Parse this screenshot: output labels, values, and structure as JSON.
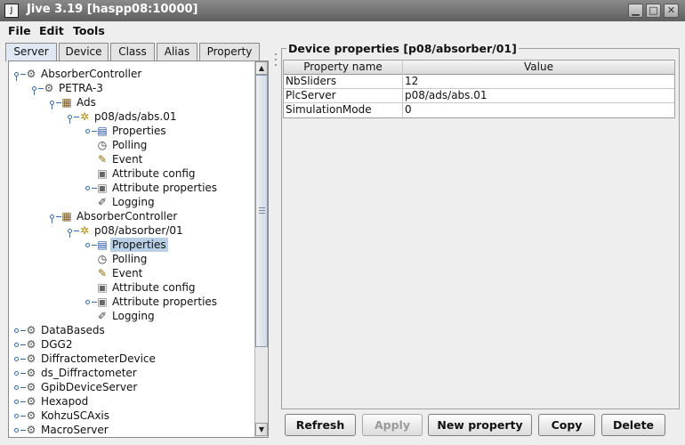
{
  "window": {
    "title": "Jive 3.19  [haspp08:10000]",
    "app_icon": "J"
  },
  "menu": [
    "File",
    "Edit",
    "Tools"
  ],
  "tabs": [
    "Server",
    "Device",
    "Class",
    "Alias",
    "Property"
  ],
  "tree": [
    {
      "label": "AbsorberController",
      "icon": "server-icon",
      "handle": "open"
    },
    {
      "label": "PETRA-3",
      "icon": "server-icon",
      "handle": "open"
    },
    {
      "label": "Ads",
      "icon": "class-icon",
      "handle": "open"
    },
    {
      "label": "p08/ads/abs.01",
      "icon": "device-icon",
      "handle": "open"
    },
    {
      "label": "Properties",
      "icon": "properties-icon",
      "handle": "closed"
    },
    {
      "label": "Polling",
      "icon": "polling-icon",
      "handle": ""
    },
    {
      "label": "Event",
      "icon": "event-icon",
      "handle": ""
    },
    {
      "label": "Attribute config",
      "icon": "attribute-config-icon",
      "handle": ""
    },
    {
      "label": "Attribute properties",
      "icon": "attribute-properties-icon",
      "handle": "closed"
    },
    {
      "label": "Logging",
      "icon": "logging-icon",
      "handle": ""
    },
    {
      "label": "AbsorberController",
      "icon": "class-icon",
      "handle": "open"
    },
    {
      "label": "p08/absorber/01",
      "icon": "device-icon",
      "handle": "open"
    },
    {
      "label": "Properties",
      "icon": "properties-icon",
      "handle": "closed",
      "selected": true
    },
    {
      "label": "Polling",
      "icon": "polling-icon",
      "handle": ""
    },
    {
      "label": "Event",
      "icon": "event-icon",
      "handle": ""
    },
    {
      "label": "Attribute config",
      "icon": "attribute-config-icon",
      "handle": ""
    },
    {
      "label": "Attribute properties",
      "icon": "attribute-properties-icon",
      "handle": "closed"
    },
    {
      "label": "Logging",
      "icon": "logging-icon",
      "handle": ""
    },
    {
      "label": "DataBaseds",
      "icon": "server-icon",
      "handle": "closed"
    },
    {
      "label": "DGG2",
      "icon": "server-icon",
      "handle": "closed"
    },
    {
      "label": "DiffractometerDevice",
      "icon": "server-icon",
      "handle": "closed"
    },
    {
      "label": "ds_Diffractometer",
      "icon": "server-icon",
      "handle": "closed"
    },
    {
      "label": "GpibDeviceServer",
      "icon": "server-icon",
      "handle": "closed"
    },
    {
      "label": "Hexapod",
      "icon": "server-icon",
      "handle": "closed"
    },
    {
      "label": "KohzuSCAxis",
      "icon": "server-icon",
      "handle": "closed"
    },
    {
      "label": "MacroServer",
      "icon": "server-icon",
      "handle": "closed"
    }
  ],
  "properties_panel": {
    "title": "Device properties [p08/absorber/01]",
    "columns": [
      "Property name",
      "Value"
    ],
    "rows": [
      {
        "name": "NbSliders",
        "value": "12"
      },
      {
        "name": "PlcServer",
        "value": "p08/ads/abs.01"
      },
      {
        "name": "SimulationMode",
        "value": "0"
      }
    ]
  },
  "buttons": {
    "refresh": "Refresh",
    "apply": "Apply",
    "new_property": "New property",
    "copy": "Copy",
    "delete": "Delete"
  }
}
